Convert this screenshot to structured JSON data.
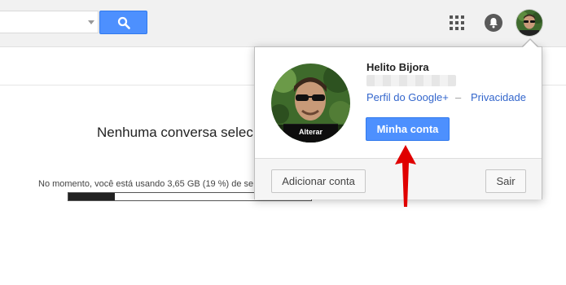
{
  "header": {
    "search_button_icon": "search-icon",
    "apps_icon": "apps-grid-icon",
    "notifications_icon": "bell-icon",
    "avatar_icon": "avatar"
  },
  "main": {
    "empty_message": "Nenhuma conversa selecio",
    "storage_text": "No momento, você está usando 3,65 GB (19 %) de se",
    "storage_fraction": 0.19
  },
  "account_popup": {
    "user_name": "Helito Bijora",
    "change_photo_label": "Alterar",
    "profile_link": "Perfil do Google+",
    "separator": "–",
    "privacy_link": "Privacidade",
    "my_account_button": "Minha conta",
    "add_account_button": "Adicionar conta",
    "sign_out_button": "Sair"
  },
  "colors": {
    "accent_blue": "#4d90fe",
    "link_blue": "#3366cc",
    "annotation_red": "#e00000"
  }
}
